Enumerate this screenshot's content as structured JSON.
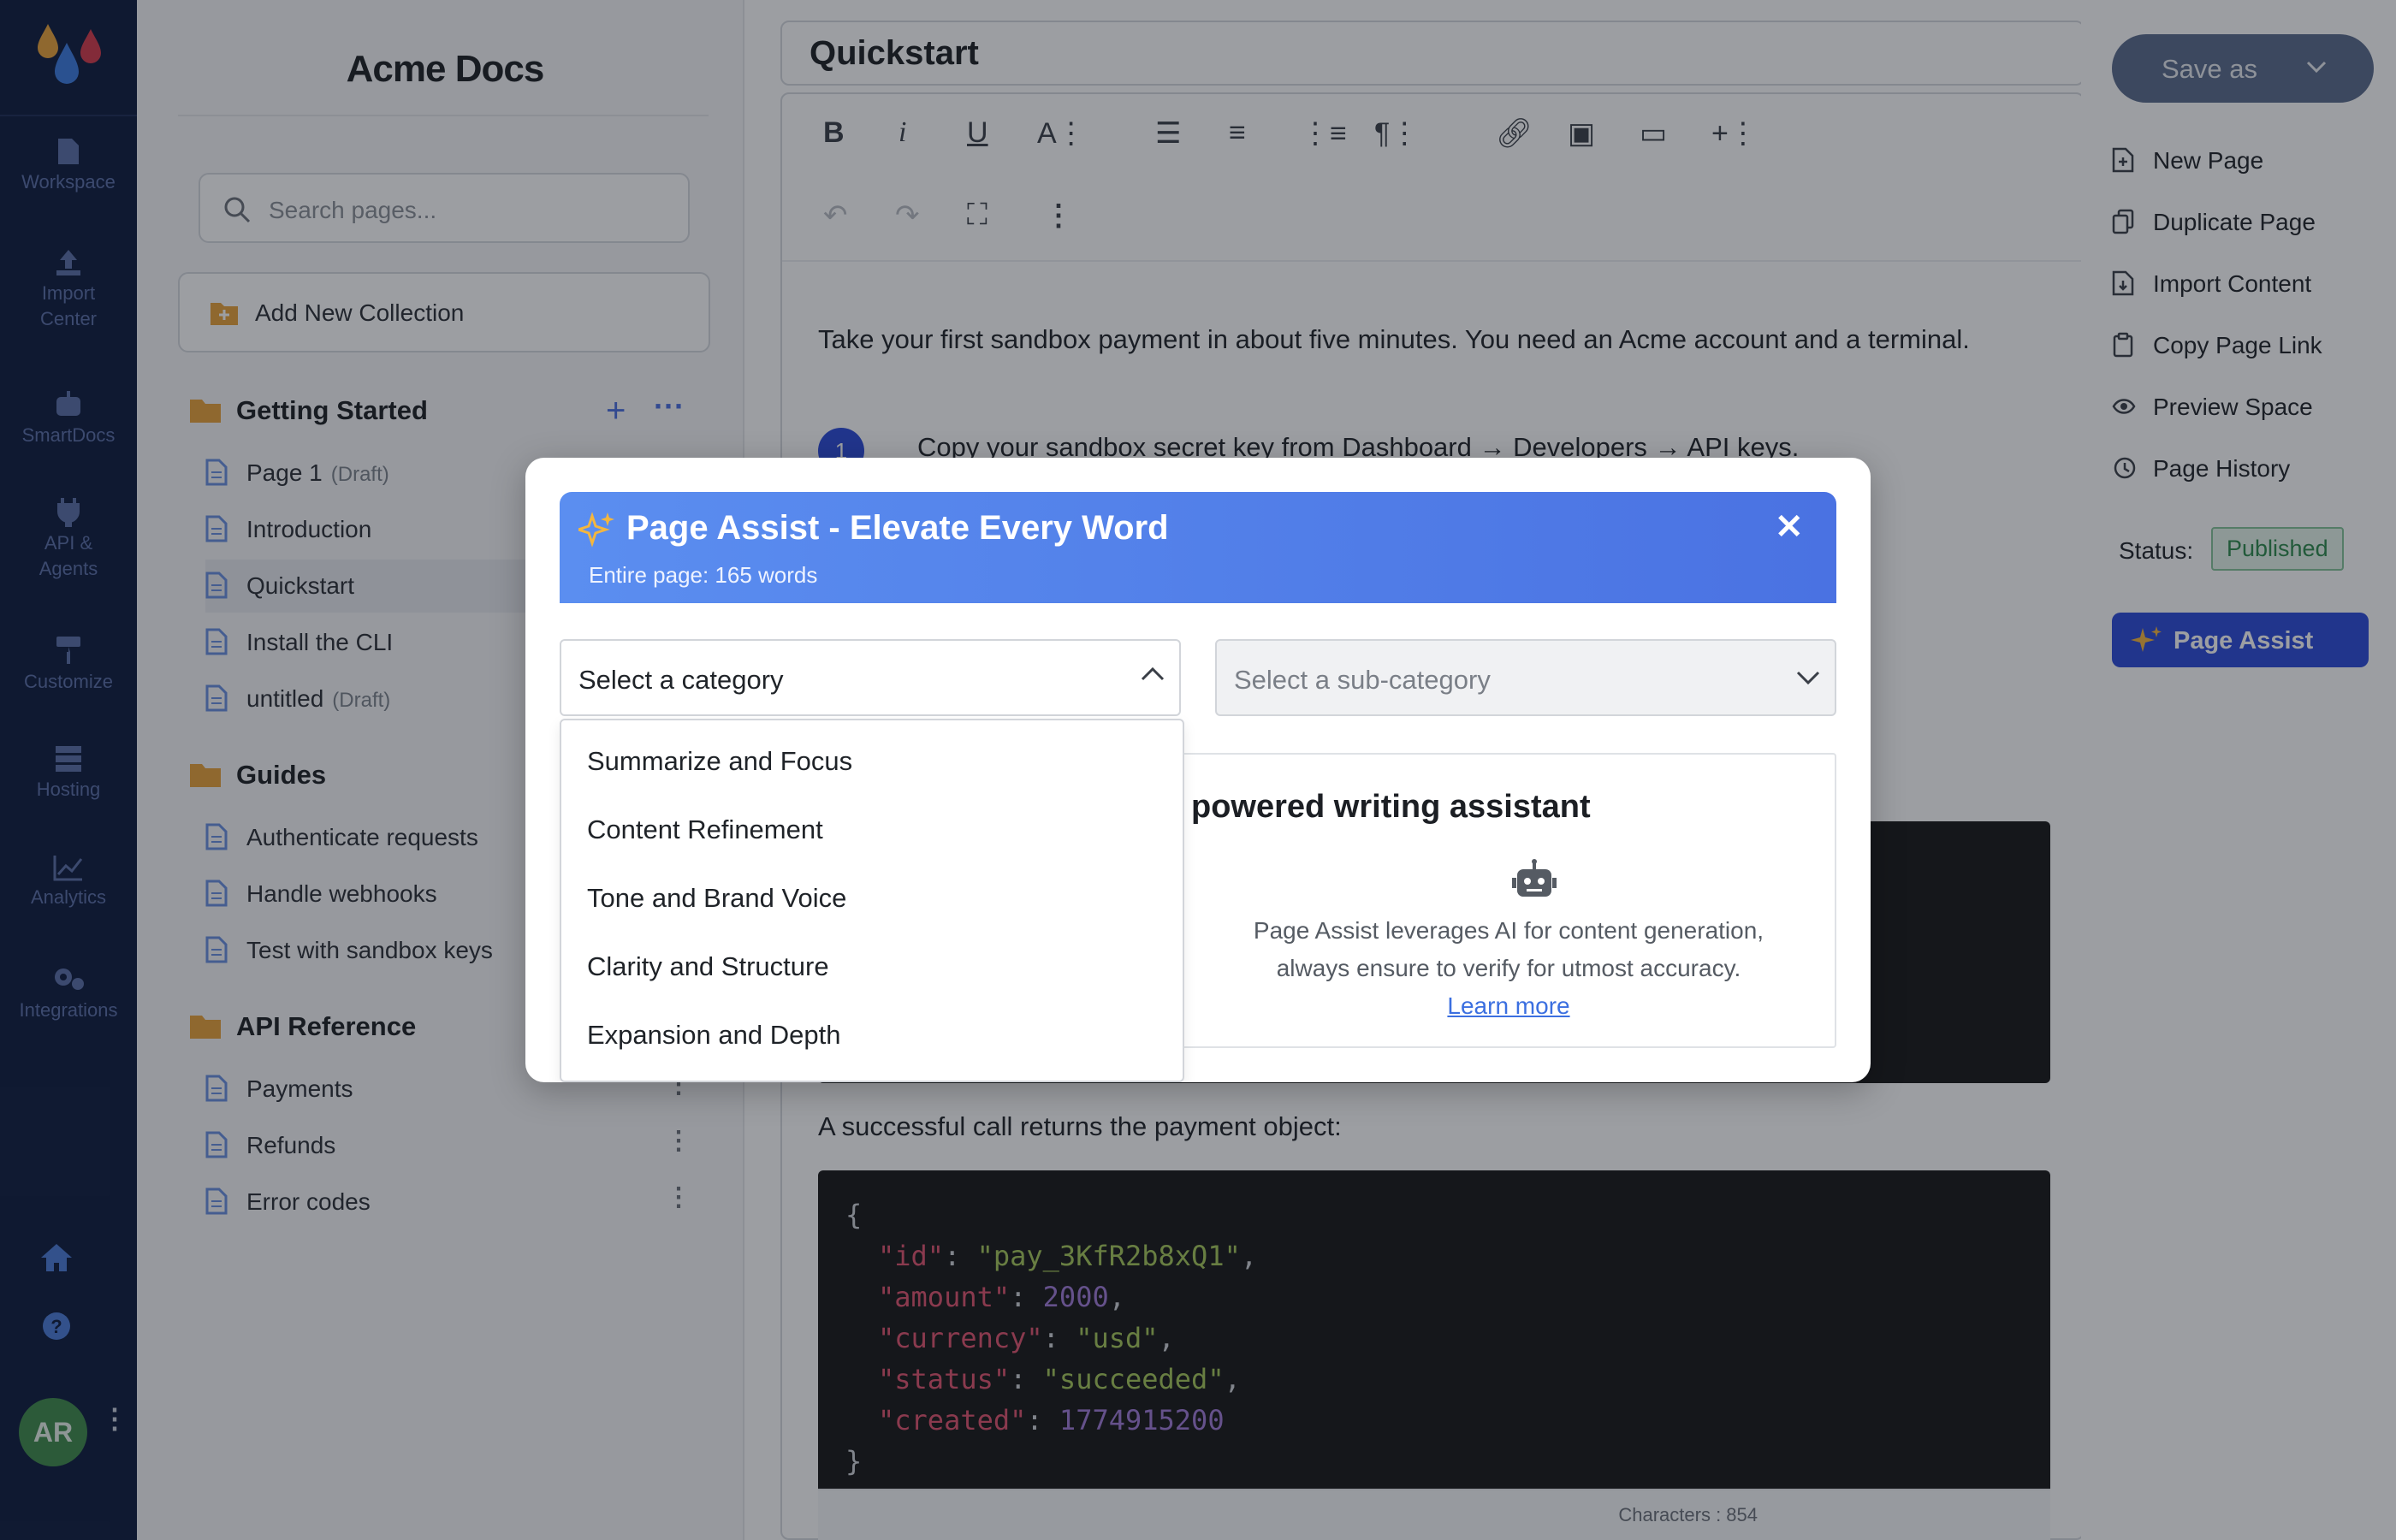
{
  "rail": {
    "items": [
      {
        "label": "Workspace",
        "icon": "document-icon"
      },
      {
        "label": "Import Center",
        "icon": "upload-icon"
      },
      {
        "label": "SmartDocs",
        "icon": "robot-icon"
      },
      {
        "label": "API & Agents",
        "icon": "plug-icon"
      },
      {
        "label": "Customize",
        "icon": "paint-roller-icon"
      },
      {
        "label": "Hosting",
        "icon": "server-icon"
      },
      {
        "label": "Analytics",
        "icon": "chart-icon"
      },
      {
        "label": "Integrations",
        "icon": "gears-icon"
      }
    ],
    "avatar_initials": "AR"
  },
  "sidebar": {
    "brand": "Acme Docs",
    "search_placeholder": "Search pages...",
    "add_collection": "Add New Collection",
    "draft_label": "(Draft)",
    "collections": [
      {
        "name": "Getting Started",
        "pages": [
          "Page 1",
          "Introduction",
          "Quickstart",
          "Install the CLI",
          "untitled"
        ]
      },
      {
        "name": "Guides",
        "pages": [
          "Authenticate requests",
          "Handle webhooks",
          "Test with sandbox keys"
        ]
      },
      {
        "name": "API Reference",
        "pages": [
          "Payments",
          "Refunds",
          "Error codes"
        ]
      }
    ]
  },
  "editor": {
    "page_title": "Quickstart",
    "intro": "Take your first sandbox payment in about five minutes. You need an Acme account and a terminal.",
    "step1_number": "1",
    "step1": "Copy your sandbox secret key from Dashboard → Developers → API keys.",
    "success_text": "A successful call returns the payment object:",
    "code": {
      "open": "{",
      "close": "}",
      "lines": [
        {
          "key": "\"id\"",
          "value": "\"pay_3KfR2b8xQ1\"",
          "kind": "s"
        },
        {
          "key": "\"amount\"",
          "value": "2000",
          "kind": "n"
        },
        {
          "key": "\"currency\"",
          "value": "\"usd\"",
          "kind": "s"
        },
        {
          "key": "\"status\"",
          "value": "\"succeeded\"",
          "kind": "s"
        },
        {
          "key": "\"created\"",
          "value": "1774915200",
          "kind": "n"
        }
      ]
    },
    "char_count": "Characters : 854"
  },
  "right": {
    "save_as": "Save as",
    "actions": [
      {
        "label": "New Page",
        "icon": "new-page-icon"
      },
      {
        "label": "Duplicate Page",
        "icon": "duplicate-icon"
      },
      {
        "label": "Import Content",
        "icon": "import-icon"
      },
      {
        "label": "Copy Page Link",
        "icon": "clipboard-icon"
      },
      {
        "label": "Preview Space",
        "icon": "eye-icon"
      },
      {
        "label": "Page History",
        "icon": "history-icon"
      }
    ],
    "status_label": "Status:",
    "status_value": "Published",
    "page_assist": "Page Assist"
  },
  "modal": {
    "title": "Page Assist - Elevate Every Word",
    "subtitle": "Entire page: 165 words",
    "category_placeholder": "Select a category",
    "subcategory_placeholder": "Select a sub-category",
    "categories": [
      "Summarize and Focus",
      "Content Refinement",
      "Tone and Brand Voice",
      "Clarity and Structure",
      "Expansion and Depth"
    ],
    "info_heading": "powered writing assistant",
    "info_text_1": "Page Assist leverages AI for content generation,",
    "info_text_2": "always ensure to verify for utmost accuracy.",
    "learn_more": "Learn more"
  },
  "colors": {
    "rail_bg": "#0d1b3d",
    "accent": "#2c4bd9",
    "published": "#2d8a4c",
    "folder": "#e8a33a"
  }
}
